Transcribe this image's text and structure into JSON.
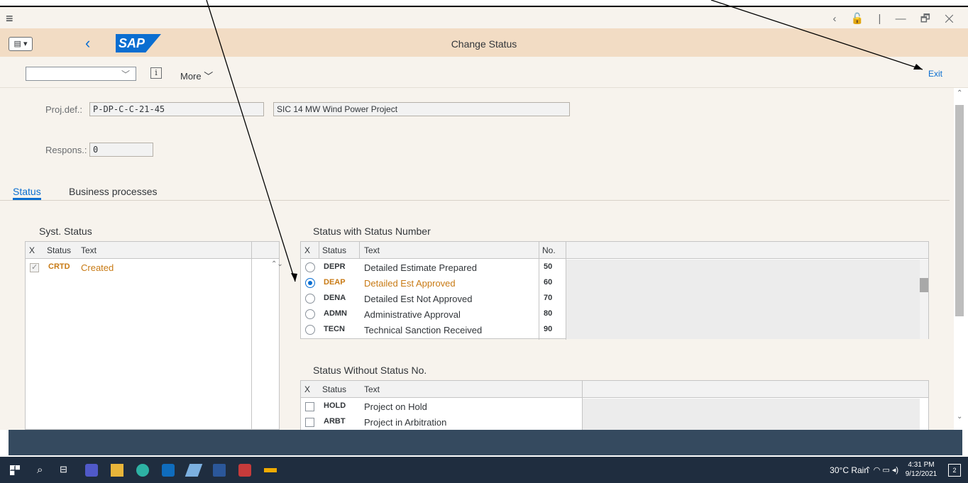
{
  "window": {
    "controls": [
      "<",
      "🔓",
      "|",
      "—",
      "🗗",
      "✕"
    ]
  },
  "shell": {
    "title": "Change Status",
    "logo": "SAP"
  },
  "toolbar": {
    "dropdown_value": "",
    "more": "More",
    "exit": "Exit"
  },
  "header": {
    "projdef_label": "Proj.def.:",
    "projdef_value": "P-DP-C-C-21-45",
    "project_name": "SIC 14 MW Wind Power Project",
    "respons_label": "Respons.:",
    "respons_value": "0"
  },
  "tabs": [
    "Status",
    "Business processes"
  ],
  "syst_status": {
    "title": "Syst. Status",
    "headers": [
      "X",
      "Status",
      "Text"
    ],
    "rows": [
      {
        "checked": true,
        "code": "CRTD",
        "text": "Created"
      }
    ]
  },
  "status_with_number": {
    "title": "Status with Status Number",
    "headers": [
      "X",
      "Status",
      "Text",
      "No."
    ],
    "rows": [
      {
        "selected": false,
        "code": "DEPR",
        "text": "Detailed Estimate Prepared",
        "no": "50"
      },
      {
        "selected": true,
        "code": "DEAP",
        "text": "Detailed Est Approved",
        "no": "60"
      },
      {
        "selected": false,
        "code": "DENA",
        "text": "Detailed Est Not Approved",
        "no": "70"
      },
      {
        "selected": false,
        "code": "ADMN",
        "text": "Administrative Approval",
        "no": "80"
      },
      {
        "selected": false,
        "code": "TECN",
        "text": "Technical Sanction Received",
        "no": "90"
      }
    ]
  },
  "status_without_number": {
    "title": "Status Without Status No.",
    "headers": [
      "X",
      "Status",
      "Text"
    ],
    "rows": [
      {
        "checked": false,
        "code": "HOLD",
        "text": "Project on Hold"
      },
      {
        "checked": false,
        "code": "ARBT",
        "text": "Project in Arbitration"
      }
    ]
  },
  "taskbar": {
    "weather": "30°C  Rain",
    "time": "4:31 PM",
    "date": "9/12/2021",
    "notifications": "2"
  },
  "colors": {
    "accent": "#0a6ed1",
    "shell": "#f2dcc4",
    "background": "#f7f3ed",
    "highlight": "#c87a14",
    "statusbar": "#354a5f"
  }
}
